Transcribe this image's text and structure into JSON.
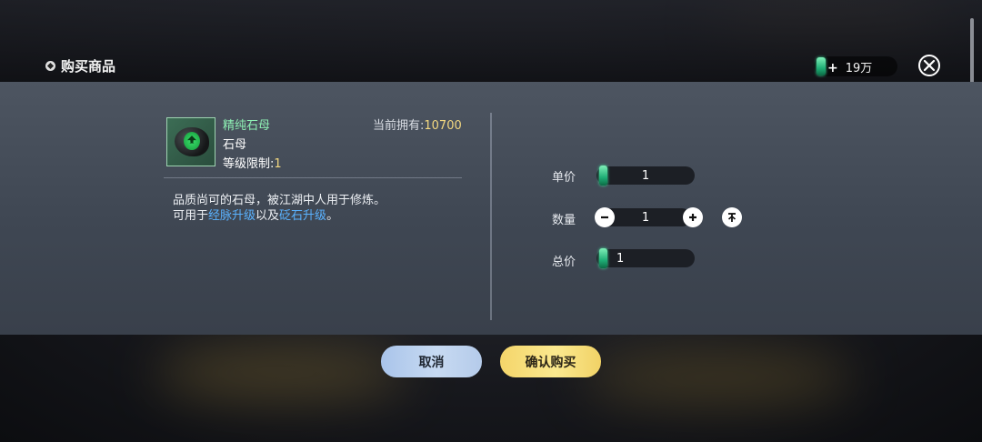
{
  "header": {
    "title": "购买商品",
    "currency_amount": "19万",
    "currency_plus": "+"
  },
  "item": {
    "name": "精纯石母",
    "type": "石母",
    "level_label": "等级限制:",
    "level_value": "1",
    "owned_label": "当前拥有:",
    "owned_value": "10700",
    "icon": "upgrade-stone-icon"
  },
  "description": {
    "line1": "品质尚可的石母，被江湖中人用于修炼。",
    "line2_prefix": "可用于",
    "link1": "经脉升级",
    "line2_mid": "以及",
    "link2": "砭石升级",
    "line2_suffix": "。"
  },
  "purchase": {
    "unit_price_label": "单价",
    "unit_price": "1",
    "quantity_label": "数量",
    "quantity": "1",
    "total_label": "总价",
    "total": "1"
  },
  "buttons": {
    "cancel": "取消",
    "confirm": "确认购买"
  },
  "colors": {
    "item_name": "#8ef0b4",
    "highlight_number": "#f3d880",
    "link": "#5ab2ff",
    "confirm_button": "#f4d56a",
    "cancel_button": "#a9c4ea"
  }
}
